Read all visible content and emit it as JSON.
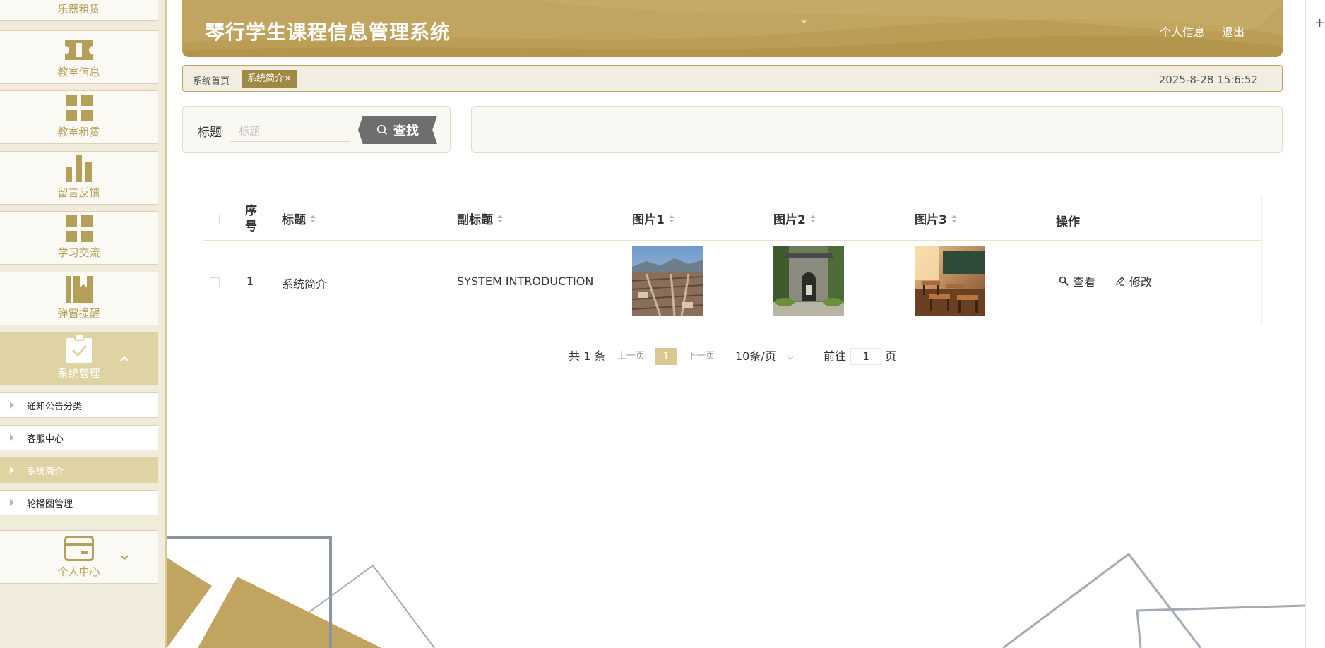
{
  "app": {
    "title": "琴行学生课程信息管理系统",
    "header_dot": "°",
    "header_links": [
      "个人信息",
      "退出"
    ]
  },
  "colors": {
    "accent": "#c0a45f",
    "accent_dark": "#a08944",
    "sidebar_bg": "#f1ebdc",
    "active_bg": "#e0d3a3",
    "search_button": "#6e6e6e"
  },
  "sidebar": {
    "items": [
      {
        "label": "乐器租赁",
        "icon": ""
      },
      {
        "label": "教室信息",
        "icon": "ticket-icon"
      },
      {
        "label": "教室租赁",
        "icon": "grid-icon"
      },
      {
        "label": "留言反馈",
        "icon": "bar-chart-icon"
      },
      {
        "label": "学习交流",
        "icon": "grid-icon"
      },
      {
        "label": "弹窗提醒",
        "icon": "bookmark-book-icon"
      },
      {
        "label": "系统管理",
        "icon": "clipboard-check-icon",
        "active": true,
        "expanded": true
      },
      {
        "label": "个人中心",
        "icon": "card-icon"
      }
    ],
    "sub_items": [
      {
        "label": "通知公告分类"
      },
      {
        "label": "客服中心"
      },
      {
        "label": "系统简介",
        "active": true
      },
      {
        "label": "轮播图管理"
      }
    ]
  },
  "breadcrumb": {
    "home": "系统首页",
    "current": "系统简介",
    "close_glyph": "×",
    "datetime": "2025-8-28 15:6:52"
  },
  "search": {
    "label": "标题",
    "placeholder": "标题",
    "value": "",
    "button_label": "查找",
    "button_icon": "search-icon"
  },
  "table": {
    "columns": [
      "序号",
      "标题",
      "副标题",
      "图片1",
      "图片2",
      "图片3",
      "操作"
    ],
    "rows": [
      {
        "index": "1",
        "title": "系统简介",
        "subtitle": "SYSTEM INTRODUCTION",
        "images": [
          "old-town-rooftops-photo",
          "stone-gate-courtyard-photo",
          "classroom-desks-photo"
        ],
        "actions": [
          {
            "label": "查看",
            "icon": "search-icon"
          },
          {
            "label": "修改",
            "icon": "edit-icon"
          }
        ]
      }
    ]
  },
  "pagination": {
    "total_text": "共 1 条",
    "prev": "上一页",
    "current_page": "1",
    "next": "下一页",
    "page_size": "10条/页",
    "goto_label": "前往",
    "goto_value": "1",
    "page_suffix": "页"
  },
  "right_edge": {
    "icon": "plus-icon",
    "glyph": "+"
  }
}
